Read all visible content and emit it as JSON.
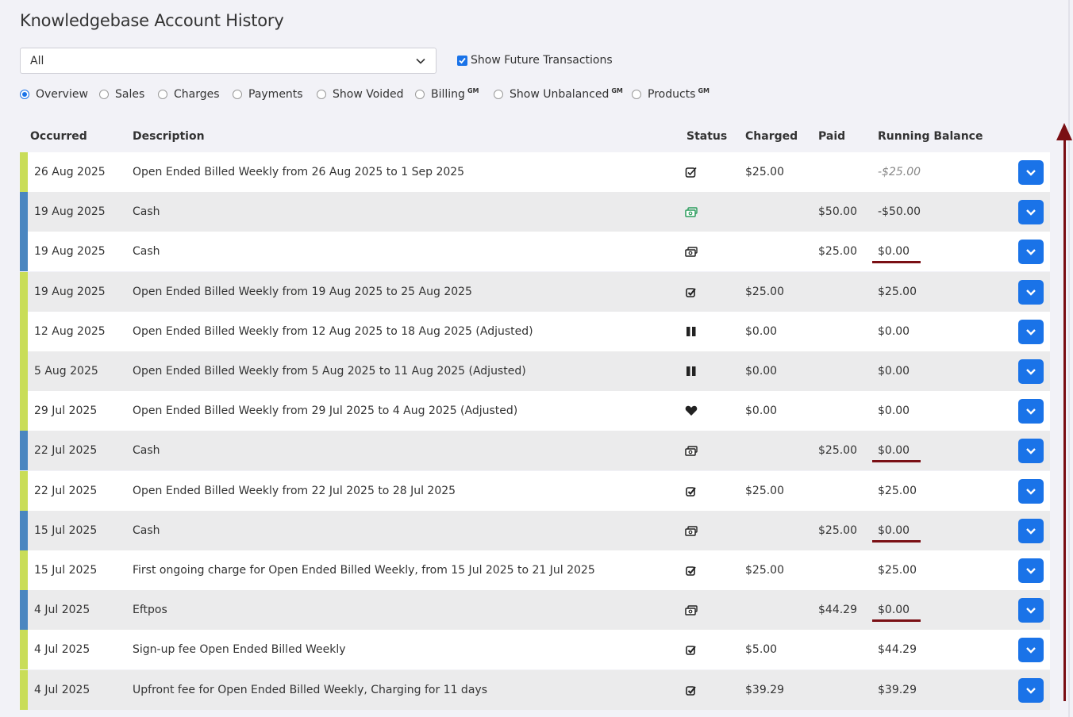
{
  "page": {
    "title": "Knowledgebase Account History"
  },
  "filter": {
    "selected": "All",
    "show_future_label": "Show Future Transactions",
    "show_future_checked": true
  },
  "views": [
    {
      "label": "Overview",
      "gm": "",
      "selected": true
    },
    {
      "label": "Sales",
      "gm": "",
      "selected": false
    },
    {
      "label": "Charges",
      "gm": "",
      "selected": false
    },
    {
      "label": "Payments",
      "gm": "",
      "selected": false
    },
    {
      "label": "Show Voided",
      "gm": "",
      "selected": false
    },
    {
      "label": "Billing",
      "gm": "GM",
      "selected": false
    },
    {
      "label": "Show Unbalanced",
      "gm": "GM",
      "selected": false
    },
    {
      "label": "Products",
      "gm": "GM",
      "selected": false
    }
  ],
  "table": {
    "headers": {
      "occurred": "Occurred",
      "description": "Description",
      "status": "Status",
      "charged": "Charged",
      "paid": "Paid",
      "balance": "Running Balance"
    },
    "colors": {
      "charge": "#c9dd58",
      "payment": "#4a86c0",
      "underline": "#7a0f14",
      "button": "#1a73e8"
    },
    "rows": [
      {
        "occurred": "26 Aug 2025",
        "description": "Open Ended Billed Weekly from 26 Aug 2025 to 1 Sep 2025",
        "status": "future-check-icon",
        "charged": "$25.00",
        "paid": "",
        "balance": "-$25.00",
        "type": "charge",
        "future": true,
        "underline": false
      },
      {
        "occurred": "19 Aug 2025",
        "description": "Cash",
        "status": "cash-green-icon",
        "charged": "",
        "paid": "$50.00",
        "balance": "-$50.00",
        "type": "payment",
        "future": false,
        "underline": false
      },
      {
        "occurred": "19 Aug 2025",
        "description": "Cash",
        "status": "cash-icon",
        "charged": "",
        "paid": "$25.00",
        "balance": "$0.00",
        "type": "payment",
        "future": false,
        "underline": true
      },
      {
        "occurred": "19 Aug 2025",
        "description": "Open Ended Billed Weekly from 19 Aug 2025 to 25 Aug 2025",
        "status": "check-icon",
        "charged": "$25.00",
        "paid": "",
        "balance": "$25.00",
        "type": "charge",
        "future": false,
        "underline": false
      },
      {
        "occurred": "12 Aug 2025",
        "description": "Open Ended Billed Weekly from 12 Aug 2025 to 18 Aug 2025 (Adjusted)",
        "status": "pause-icon",
        "charged": "$0.00",
        "paid": "",
        "balance": "$0.00",
        "type": "charge",
        "future": false,
        "underline": false
      },
      {
        "occurred": "5 Aug 2025",
        "description": "Open Ended Billed Weekly from 5 Aug 2025 to 11 Aug 2025 (Adjusted)",
        "status": "pause-icon",
        "charged": "$0.00",
        "paid": "",
        "balance": "$0.00",
        "type": "charge",
        "future": false,
        "underline": false
      },
      {
        "occurred": "29 Jul 2025",
        "description": "Open Ended Billed Weekly from 29 Jul 2025 to 4 Aug 2025 (Adjusted)",
        "status": "heart-icon",
        "charged": "$0.00",
        "paid": "",
        "balance": "$0.00",
        "type": "charge",
        "future": false,
        "underline": false
      },
      {
        "occurred": "22 Jul 2025",
        "description": "Cash",
        "status": "cash-icon",
        "charged": "",
        "paid": "$25.00",
        "balance": "$0.00",
        "type": "payment",
        "future": false,
        "underline": true
      },
      {
        "occurred": "22 Jul 2025",
        "description": "Open Ended Billed Weekly from 22 Jul 2025 to 28 Jul 2025",
        "status": "check-icon",
        "charged": "$25.00",
        "paid": "",
        "balance": "$25.00",
        "type": "charge",
        "future": false,
        "underline": false
      },
      {
        "occurred": "15 Jul 2025",
        "description": "Cash",
        "status": "cash-icon",
        "charged": "",
        "paid": "$25.00",
        "balance": "$0.00",
        "type": "payment",
        "future": false,
        "underline": true
      },
      {
        "occurred": "15 Jul 2025",
        "description": "First ongoing charge for Open Ended Billed Weekly, from 15 Jul 2025 to 21 Jul 2025",
        "status": "check-icon",
        "charged": "$25.00",
        "paid": "",
        "balance": "$25.00",
        "type": "charge",
        "future": false,
        "underline": false
      },
      {
        "occurred": "4 Jul 2025",
        "description": "Eftpos",
        "status": "cash-icon",
        "charged": "",
        "paid": "$44.29",
        "balance": "$0.00",
        "type": "payment",
        "future": false,
        "underline": true
      },
      {
        "occurred": "4 Jul 2025",
        "description": "Sign-up fee Open Ended Billed Weekly",
        "status": "check-icon",
        "charged": "$5.00",
        "paid": "",
        "balance": "$44.29",
        "type": "charge",
        "future": false,
        "underline": false
      },
      {
        "occurred": "4 Jul 2025",
        "description": "Upfront fee for Open Ended Billed Weekly, Charging for 11 days",
        "status": "check-icon",
        "charged": "$39.29",
        "paid": "",
        "balance": "$39.29",
        "type": "charge",
        "future": false,
        "underline": false
      }
    ]
  }
}
